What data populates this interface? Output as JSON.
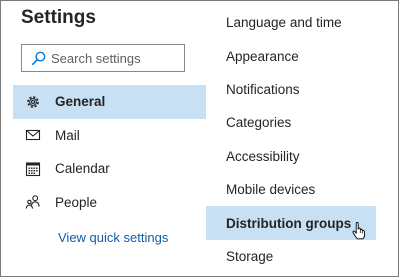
{
  "header": {
    "title": "Settings"
  },
  "search": {
    "placeholder": "Search settings"
  },
  "left_nav": {
    "items": [
      {
        "label": "General",
        "icon": "gear-icon",
        "selected": true
      },
      {
        "label": "Mail",
        "icon": "mail-icon",
        "selected": false
      },
      {
        "label": "Calendar",
        "icon": "calendar-icon",
        "selected": false
      },
      {
        "label": "People",
        "icon": "people-icon",
        "selected": false
      }
    ],
    "quick_settings_link": "View quick settings"
  },
  "right_nav": {
    "items": [
      {
        "label": "Language and time",
        "selected": false
      },
      {
        "label": "Appearance",
        "selected": false
      },
      {
        "label": "Notifications",
        "selected": false
      },
      {
        "label": "Categories",
        "selected": false
      },
      {
        "label": "Accessibility",
        "selected": false
      },
      {
        "label": "Mobile devices",
        "selected": false
      },
      {
        "label": "Distribution groups",
        "selected": true
      },
      {
        "label": "Storage",
        "selected": false
      }
    ]
  },
  "colors": {
    "selection_bg": "#c7e0f4",
    "accent": "#0078d4",
    "link": "#0f5ea7",
    "text": "#252423"
  }
}
